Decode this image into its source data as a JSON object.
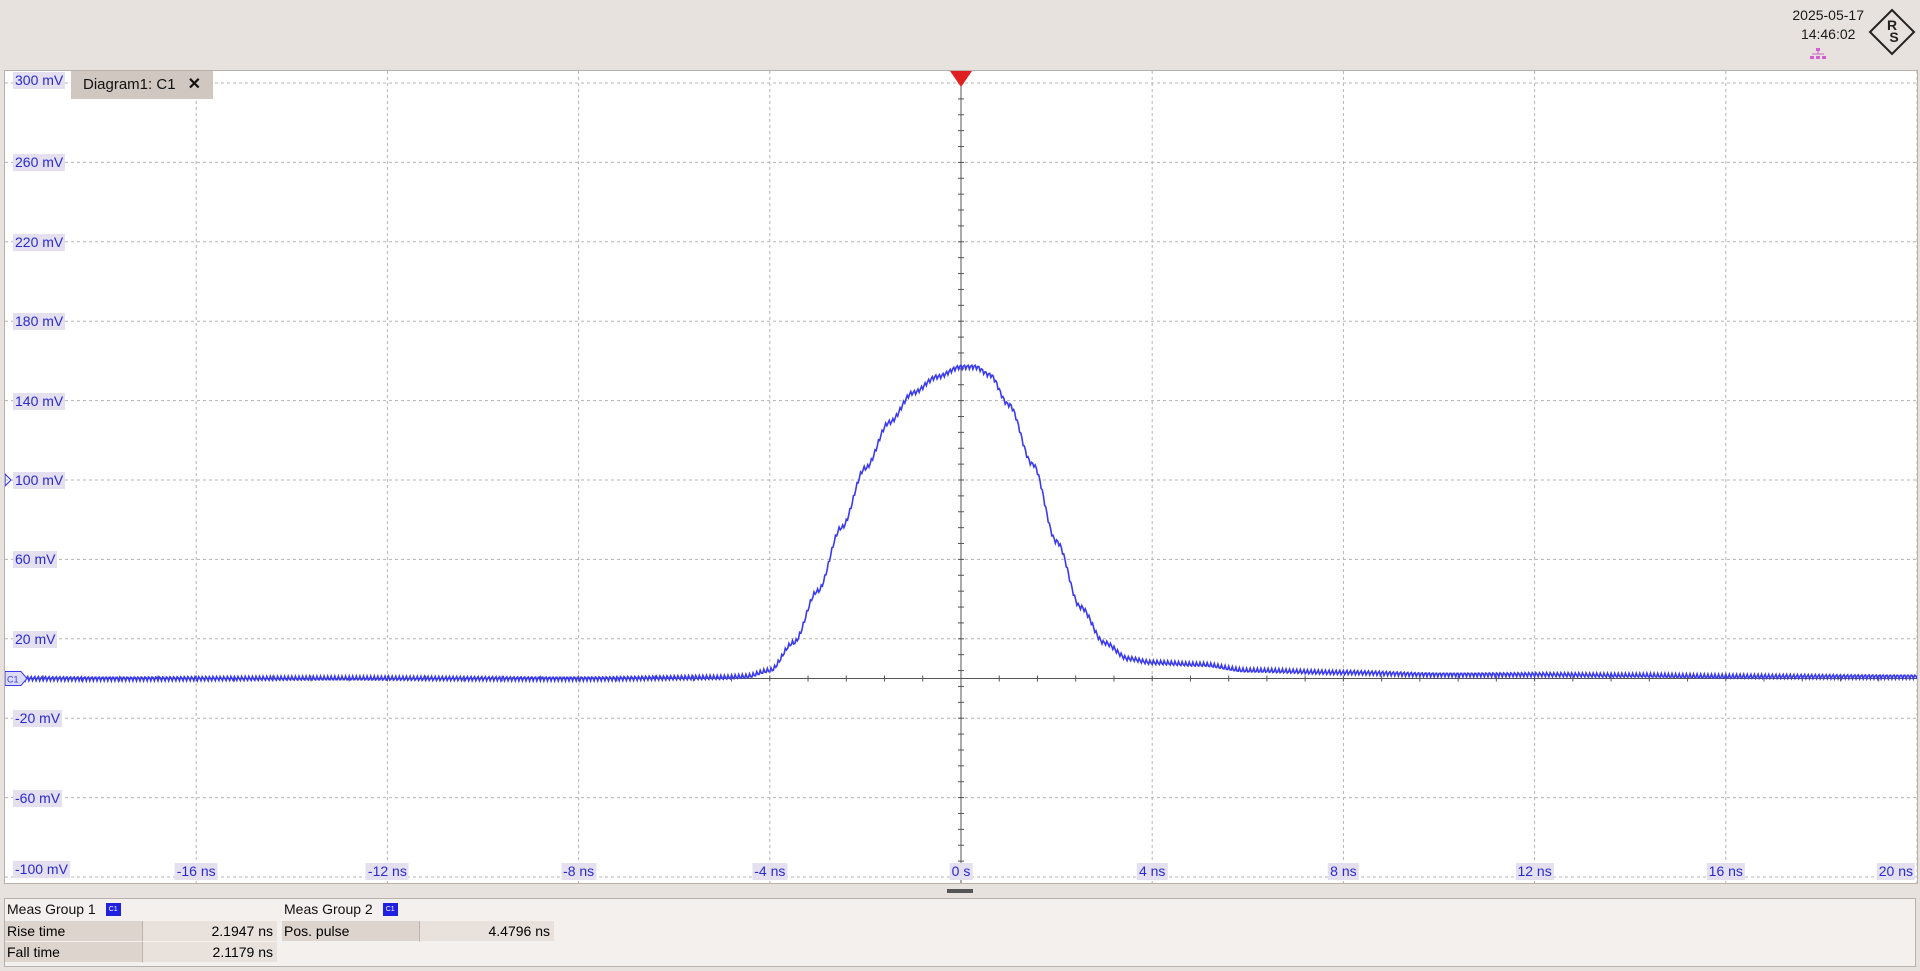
{
  "header": {
    "date": "2025-05-17",
    "time": "14:46:02",
    "logo_text": "RS",
    "icons": [
      "network-icon",
      "rs-logo"
    ]
  },
  "diagram": {
    "tab_label": "Diagram1: C1",
    "close_glyph": "✕",
    "channel_marker": "C1",
    "trace_color": "#3a3af0",
    "trigger_color": "#e02020"
  },
  "chart_data": {
    "type": "line",
    "title": "",
    "xlabel": "",
    "ylabel": "",
    "xlim": [
      -20,
      20
    ],
    "ylim": [
      -100,
      300
    ],
    "grid": true,
    "x_ticks": [
      {
        "value": -16,
        "label": "-16 ns"
      },
      {
        "value": -12,
        "label": "-12 ns"
      },
      {
        "value": -8,
        "label": "-8 ns"
      },
      {
        "value": -4,
        "label": "-4 ns"
      },
      {
        "value": 0,
        "label": "0 s"
      },
      {
        "value": 4,
        "label": "4 ns"
      },
      {
        "value": 8,
        "label": "8 ns"
      },
      {
        "value": 12,
        "label": "12 ns"
      },
      {
        "value": 16,
        "label": "16 ns"
      },
      {
        "value": 20,
        "label": "20 ns"
      }
    ],
    "y_ticks": [
      {
        "value": 300,
        "label": "300 mV"
      },
      {
        "value": 260,
        "label": "260 mV"
      },
      {
        "value": 220,
        "label": "220 mV"
      },
      {
        "value": 180,
        "label": "180 mV"
      },
      {
        "value": 140,
        "label": "140 mV"
      },
      {
        "value": 100,
        "label": "100 mV"
      },
      {
        "value": 60,
        "label": "60 mV"
      },
      {
        "value": 20,
        "label": "20 mV"
      },
      {
        "value": -20,
        "label": "-20 mV"
      },
      {
        "value": -60,
        "label": "-60 mV"
      },
      {
        "value": -100,
        "label": "-100 mV"
      }
    ],
    "series": [
      {
        "color": "#3a3af0",
        "x": [
          -20,
          -16,
          -12,
          -8,
          -5,
          -4.5,
          -4,
          -3.5,
          -3,
          -2.5,
          -2,
          -1.5,
          -1,
          -0.5,
          0,
          0.3,
          0.6,
          1,
          1.5,
          2,
          2.5,
          3,
          3.5,
          4,
          5,
          6,
          8,
          10,
          12,
          14,
          16,
          18,
          20
        ],
        "y": [
          0,
          0,
          0,
          0,
          0.5,
          1,
          4,
          18,
          44,
          76,
          106,
          129,
          144,
          152,
          157,
          157,
          153,
          138,
          108,
          69,
          36,
          18,
          10,
          8,
          7,
          4,
          3,
          2,
          2,
          1.5,
          1,
          1,
          1
        ]
      }
    ]
  },
  "measurements": {
    "groups": [
      {
        "title": "Meas Group 1",
        "badge": "C1",
        "rows": [
          {
            "label": "Rise time",
            "value": "2.1947 ns"
          },
          {
            "label": "Fall time",
            "value": "2.1179 ns"
          }
        ]
      },
      {
        "title": "Meas Group 2",
        "badge": "C1",
        "rows": [
          {
            "label": "Pos. pulse",
            "value": "4.4796 ns"
          }
        ]
      }
    ]
  }
}
